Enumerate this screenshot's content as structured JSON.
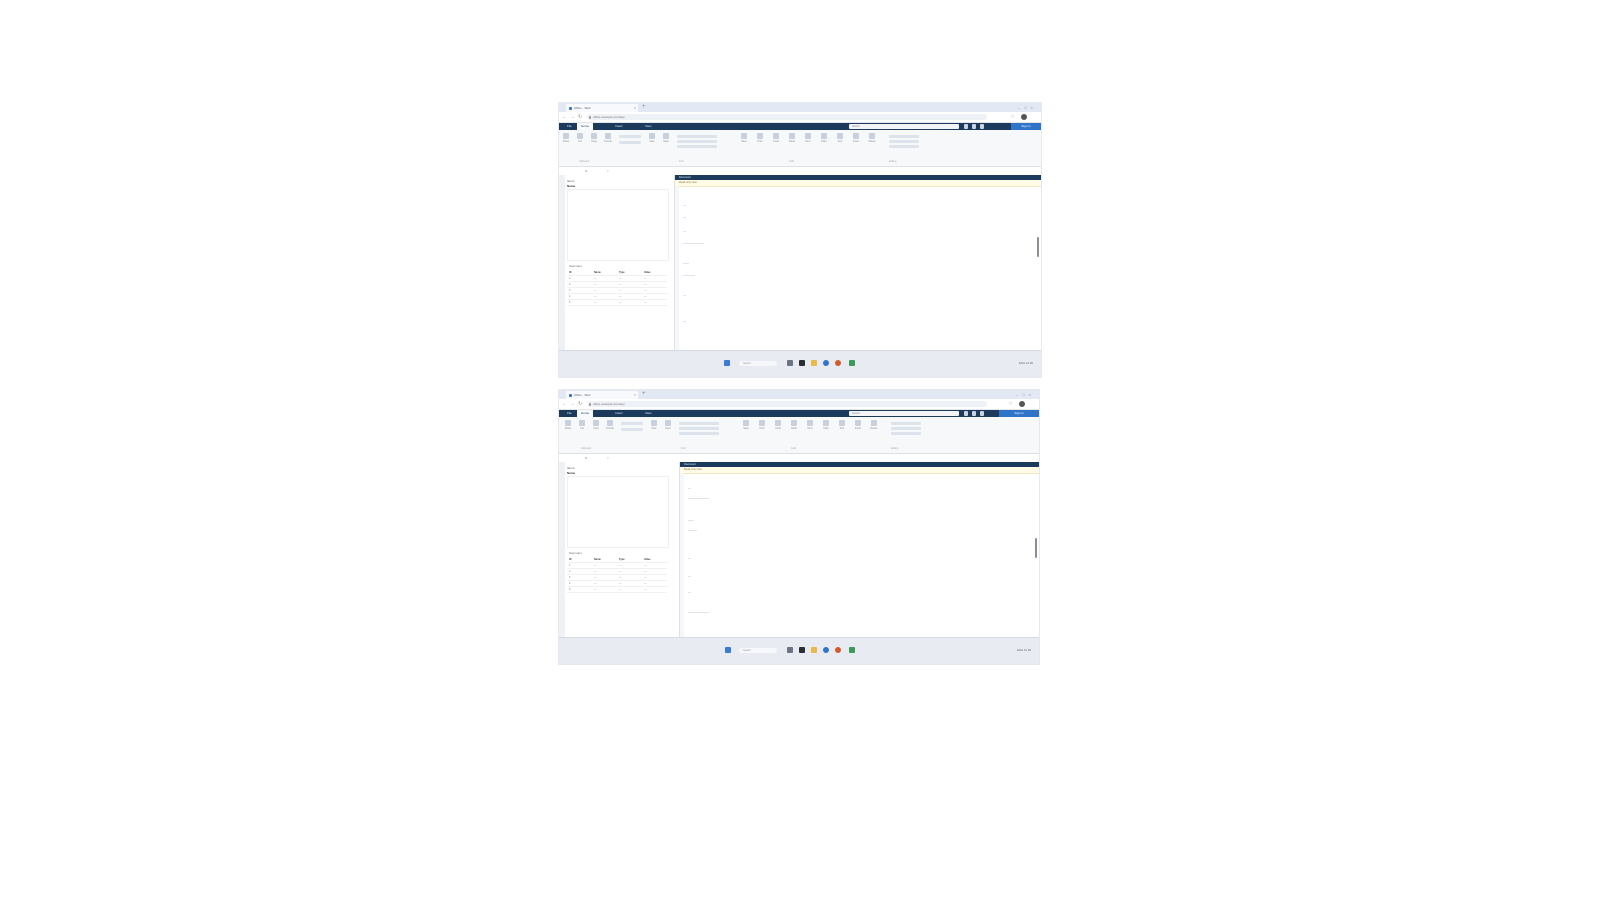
{
  "screens": [
    {
      "browser": {
        "tab_title": "Office · Web",
        "url": "office.example.com/app"
      },
      "app": {
        "tabs": [
          "File",
          "Home",
          "Insert",
          "View"
        ],
        "active_tab": "Home",
        "search_placeholder": "Search",
        "signin_label": "Sign in"
      },
      "ribbon": {
        "buttons": [
          "Paste",
          "Cut",
          "Copy",
          "Format",
          "New",
          "Open",
          "Save",
          "Print",
          "Undo",
          "Redo",
          "Find",
          "Filter",
          "Sort",
          "Insert",
          "Delete",
          "Share"
        ],
        "groups": [
          "Clipboard",
          "Font",
          "Cells",
          "Editing"
        ]
      },
      "query_bar": {
        "fx": "fx",
        "text": "="
      },
      "left_pane": {
        "header": "Items",
        "subheader": "Name",
        "section": "Summary",
        "table": {
          "headers": [
            "ID",
            "Name",
            "Type",
            "Value"
          ],
          "rows": [
            [
              "1",
              "—",
              "—",
              "—"
            ],
            [
              "2",
              "—",
              "—",
              "—"
            ],
            [
              "3",
              "—",
              "—",
              "—"
            ],
            [
              "4",
              "—",
              "—",
              "—"
            ],
            [
              "5",
              "—",
              "—",
              "—"
            ]
          ]
        }
      },
      "right_pane": {
        "title": "Document",
        "notice": "Read-only view",
        "lines": [
          "—",
          "—",
          "—",
          "———————",
          "——",
          "————",
          "—",
          "—"
        ]
      },
      "taskbar": {
        "search_placeholder": "Search",
        "tray_text": "ENG  12:00"
      }
    },
    {
      "browser": {
        "tab_title": "Office · Web",
        "url": "office.example.com/app"
      },
      "app": {
        "tabs": [
          "File",
          "Home",
          "Insert",
          "View"
        ],
        "active_tab": "Home",
        "search_placeholder": "Search",
        "signin_label": "Sign in"
      },
      "ribbon": {
        "buttons": [
          "Paste",
          "Cut",
          "Copy",
          "Format",
          "New",
          "Open",
          "Save",
          "Print",
          "Undo",
          "Redo",
          "Find",
          "Filter",
          "Sort",
          "Insert",
          "Delete",
          "Share"
        ],
        "groups": [
          "Clipboard",
          "Font",
          "Cells",
          "Editing"
        ]
      },
      "query_bar": {
        "fx": "fx",
        "text": "="
      },
      "left_pane": {
        "header": "Items",
        "subheader": "Name",
        "section": "Summary",
        "table": {
          "headers": [
            "ID",
            "Name",
            "Type",
            "Value"
          ],
          "rows": [
            [
              "1",
              "—",
              "—",
              "—"
            ],
            [
              "2",
              "—",
              "—",
              "—"
            ],
            [
              "3",
              "—",
              "—",
              "—"
            ],
            [
              "4",
              "—",
              "—",
              "—"
            ],
            [
              "5",
              "—",
              "—",
              "—"
            ]
          ]
        }
      },
      "right_pane": {
        "title": "Document",
        "notice": "Read-only view",
        "lines": [
          "—",
          "———————",
          "——",
          "———",
          "—",
          "—",
          "—",
          "———————"
        ]
      },
      "taskbar": {
        "search_placeholder": "Search",
        "tray_text": "ENG  12:00"
      }
    }
  ],
  "colors": {
    "app_header": "#1b3a5c",
    "accent": "#2f74c9",
    "notice": "#fffbe6",
    "taskbar": "#e8ecf2"
  },
  "icons": {
    "taskbar": [
      "windows-icon",
      "search-icon",
      "task-view-icon",
      "explorer-icon",
      "edge-icon",
      "store-icon",
      "mail-icon",
      "settings-icon"
    ]
  }
}
